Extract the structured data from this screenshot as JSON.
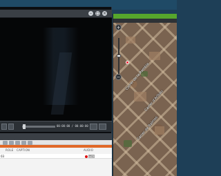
{
  "video": {
    "timecode": "00:00:00 / 00:00:00",
    "fullscreen_label": "⛶"
  },
  "list": {
    "columns": [
      "ROLE",
      "CAPTION",
      "AUDIO"
    ],
    "rows": [
      {
        "id": "03",
        "audio_label": "Play"
      }
    ]
  },
  "map": {
    "labels": [
      "Carrer de la Rambla",
      "Carrer de Balmes",
      "Carrer d'Aribau"
    ],
    "zoom_in": "+",
    "zoom_out": "−"
  },
  "colors": {
    "accent_orange": "#e16827",
    "map_title_green": "#56a62c",
    "record_red": "#dd1111"
  },
  "icons": [
    "close-icon",
    "minimize-icon",
    "maximize-icon",
    "play-icon",
    "fullscreen-icon",
    "zoom-in-icon",
    "zoom-out-icon",
    "record-icon"
  ]
}
